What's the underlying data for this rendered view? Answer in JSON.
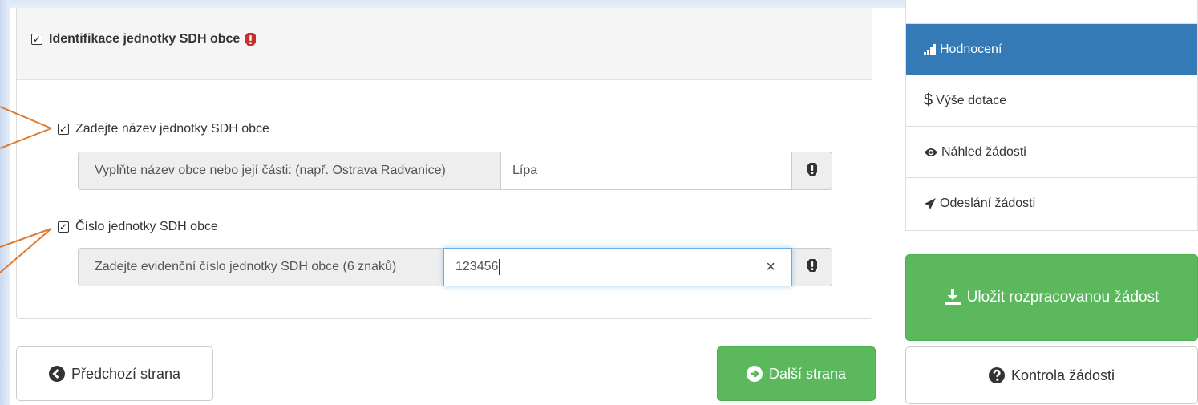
{
  "section": {
    "title": "Identifikace jednotky SDH obce"
  },
  "fields": [
    {
      "label": "Zadejte název jednotky SDH obce",
      "addon": "Vyplňte název obce nebo její části: (např. Ostrava Radvanice)",
      "value": "Lípa"
    },
    {
      "label": "Číslo jednotky SDH obce",
      "addon": "Zadejte evidenční číslo jednotky SDH obce (6 znaků)",
      "value": "123456",
      "clear": "×"
    }
  ],
  "nav": {
    "items": [
      {
        "label": "Hodnocení",
        "icon": "signal-icon",
        "active": true
      },
      {
        "label": "Výše dotace",
        "icon": "dollar-icon",
        "active": false
      },
      {
        "label": "Náhled žádosti",
        "icon": "eye-icon",
        "active": false
      },
      {
        "label": "Odeslání žádosti",
        "icon": "send-icon",
        "active": false
      }
    ]
  },
  "buttons": {
    "prev": "Předchozí strana",
    "next": "Další strana",
    "save": "Uložit rozpracovanou žádost",
    "check": "Kontrola žádosti"
  },
  "colors": {
    "primary": "#337ab7",
    "success": "#5cb85c",
    "danger": "#c9302c",
    "callout": "#e07b2e"
  }
}
